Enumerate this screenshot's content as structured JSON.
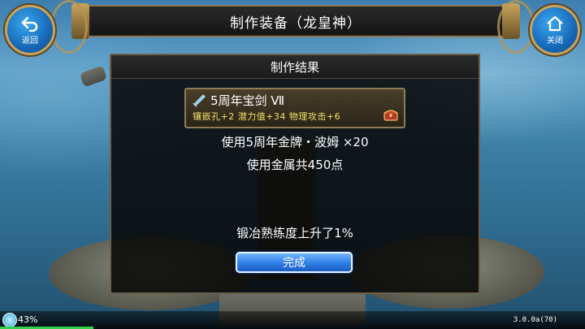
{
  "header": {
    "title": "制作装备（龙皇神）"
  },
  "back_button": {
    "icon": "back-arrow-icon",
    "label": "返回"
  },
  "close_button": {
    "icon": "home-icon",
    "label": "关闭"
  },
  "dialog": {
    "title": "制作结果",
    "item": {
      "icon": "sword-icon",
      "name": "5周年宝剑  Ⅶ",
      "stats": "镶嵌孔+2  潜力值+34  物理攻击+6",
      "detail_icon": "chest-icon"
    },
    "materials_line": "使用5周年金牌・波姆  ×20",
    "metal_line": "使用金属共450点",
    "proficiency_line": "锻冶熟练度上升了1%",
    "done_label": "完成"
  },
  "status": {
    "battery_icon": "battery-icon",
    "battery_percent": "43%",
    "version": "3.0.0a(70)",
    "progress_fraction": 0.16
  },
  "colors": {
    "accent_gold": "#c9a35a",
    "stat_yellow": "#f3e16a",
    "button_blue": "#2f7ee5",
    "progress_green": "#2fd04a"
  }
}
